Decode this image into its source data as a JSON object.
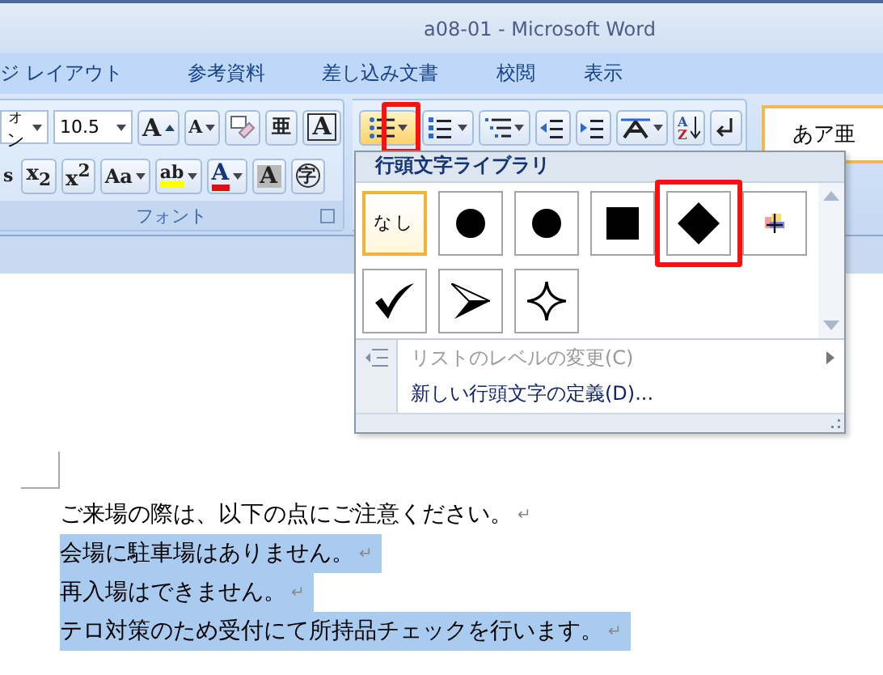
{
  "window": {
    "title": "a08-01 - Microsoft Word"
  },
  "ribbon_tabs": [
    {
      "label": "ジ レイアウト",
      "selected": false
    },
    {
      "label": "参考資料",
      "selected": false
    },
    {
      "label": "差し込み文書",
      "selected": false
    },
    {
      "label": "校閲",
      "selected": false
    },
    {
      "label": "表示",
      "selected": false
    }
  ],
  "font_group": {
    "font_name": "ォン",
    "font_size": "10.5",
    "label": "フォント",
    "row_1": [
      {
        "kind": "grow",
        "glyph": "A"
      },
      {
        "kind": "shrink",
        "glyph": "A"
      },
      {
        "kind": "clear"
      },
      {
        "kind": "ruby",
        "glyph": "亜"
      },
      {
        "kind": "border",
        "glyph": "A"
      }
    ],
    "row_2": [
      {
        "kind": "cut",
        "glyph": "s"
      },
      {
        "kind": "script",
        "glyph": "x$_{2}$"
      },
      {
        "kind": "script",
        "glyph": "x$^{2}$"
      },
      {
        "kind": "case",
        "glyph": "Aa"
      },
      {
        "kind": "highlight",
        "glyph": "ab"
      },
      {
        "kind": "color",
        "glyph": "A"
      },
      {
        "kind": "shade",
        "glyph": "A"
      },
      {
        "kind": "enclose",
        "glyph": "字"
      }
    ]
  },
  "paragraph_group": {
    "tools": [
      {
        "kind": "bullets",
        "highlighted": true
      },
      {
        "kind": "numbering",
        "highlighted": false
      },
      {
        "kind": "multilevel",
        "highlighted": false
      },
      {
        "kind": "outdent",
        "highlighted": false
      },
      {
        "kind": "indent",
        "highlighted": false
      },
      {
        "kind": "asian",
        "highlighted": false
      },
      {
        "kind": "sort",
        "glyph_top": "A",
        "glyph_bottom": "Z",
        "highlighted": false
      },
      {
        "kind": "marks",
        "highlighted": false
      }
    ]
  },
  "styles_group": {
    "preview": "あア亜"
  },
  "bullet_menu": {
    "header": "行頭文字ライブラリ",
    "tiles": [
      {
        "kind": "none",
        "label": "なし",
        "selected": true,
        "highlighted": false
      },
      {
        "kind": "disc",
        "selected": false,
        "highlighted": false
      },
      {
        "kind": "disc",
        "selected": false,
        "highlighted": false
      },
      {
        "kind": "square",
        "selected": false,
        "highlighted": false
      },
      {
        "kind": "diamond",
        "selected": false,
        "highlighted": true
      },
      {
        "kind": "picture",
        "selected": false,
        "highlighted": false
      },
      {
        "kind": "check",
        "selected": false,
        "highlighted": false
      },
      {
        "kind": "arrowhead",
        "selected": false,
        "highlighted": false
      },
      {
        "kind": "star",
        "selected": false,
        "highlighted": false
      }
    ],
    "items": [
      {
        "label": "リストのレベルの変更(C)",
        "disabled": true,
        "submenu": true,
        "icon": true
      },
      {
        "label": "新しい行頭文字の定義(D)...",
        "disabled": false,
        "submenu": false,
        "icon": false
      }
    ]
  },
  "document": {
    "lines": [
      {
        "text": "ご来場の際は、以下の点にご注意ください。",
        "mark": "↵",
        "selected": false
      },
      {
        "text": "会場に駐車場はありません。",
        "mark": "↵",
        "selected": true
      },
      {
        "text": "再入場はできません。",
        "mark": "↵",
        "selected": true
      },
      {
        "text": "テロ対策のため受付にて所持品チェックを行います。",
        "mark": "↵",
        "selected": true
      }
    ]
  }
}
